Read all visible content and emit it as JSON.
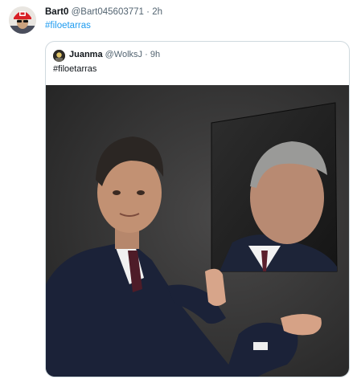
{
  "tweet": {
    "author": {
      "display_name": "Bart0",
      "handle": "@Bart045603771",
      "separator": "·",
      "time": "2h"
    },
    "text": "#filoetarras"
  },
  "quoted_tweet": {
    "author": {
      "display_name": "Juanma",
      "handle": "@WolksJ",
      "separator": "·",
      "time": "9h"
    },
    "text": "#filoetarras"
  },
  "colors": {
    "link": "#1d9bf0",
    "secondary_text": "#536471",
    "border": "#cfd9de"
  }
}
